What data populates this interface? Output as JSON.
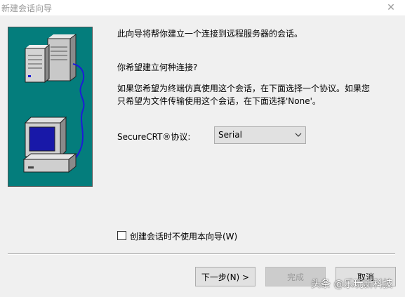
{
  "window": {
    "title": "新建会话向导",
    "close_glyph": "✕"
  },
  "content": {
    "intro": "此向导将帮你建立一个连接到远程服务器的会话。",
    "question": "你希望建立何种连接?",
    "hint_line1": "如果您希望为终端仿真使用这个会话，在下面选择一个协议。如果您",
    "hint_line2": "只希望为文件传输使用这个会话，在下面选择'None'。"
  },
  "protocol": {
    "label": "SecureCRT®协议:",
    "selected": "Serial"
  },
  "skip_wizard": {
    "label": "创建会话时不使用本向导(W)",
    "checked": false
  },
  "buttons": {
    "next": "下一步(N) >",
    "finish": "完成",
    "cancel": "取消"
  },
  "watermark": "头条 @乐玩新科技",
  "colors": {
    "illustration_bg": "#047d7c",
    "cable": "#1c1cd8",
    "monitor_screen": "#1818a8"
  }
}
